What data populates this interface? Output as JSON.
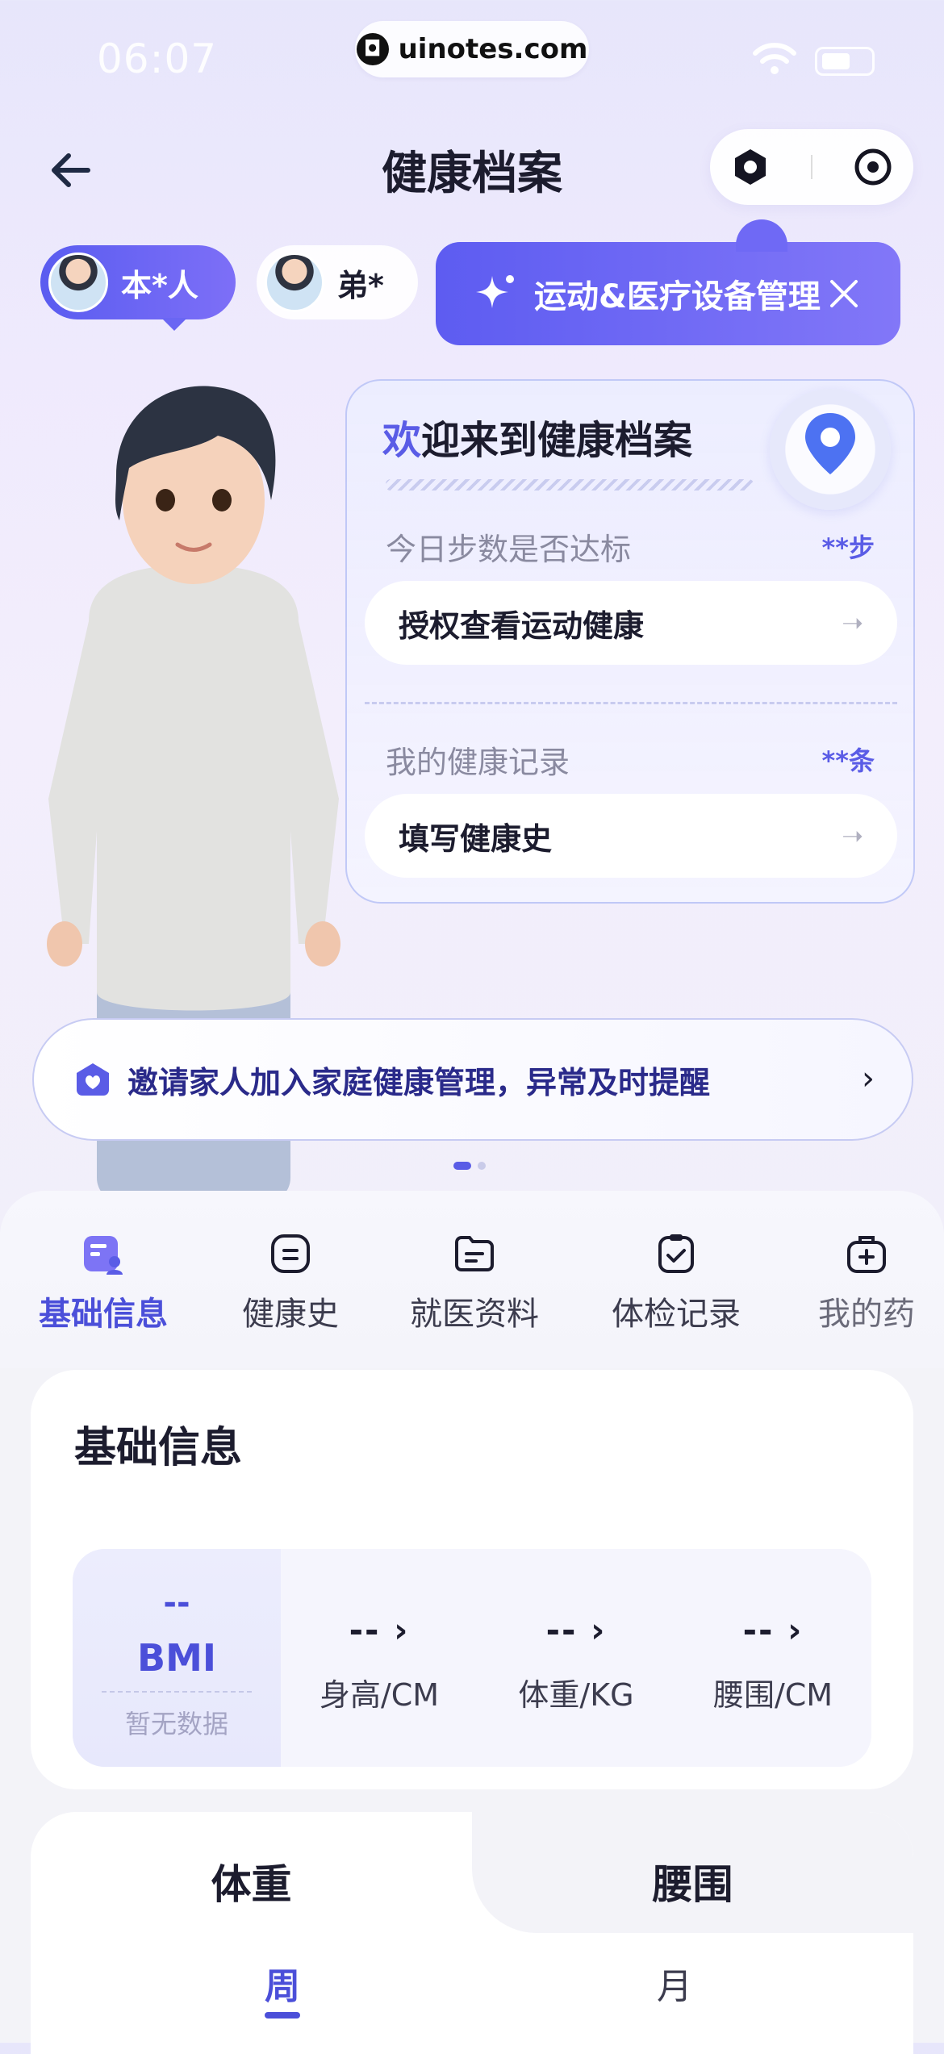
{
  "status_bar": {
    "time": "06:07",
    "url": "uinotes.com"
  },
  "header": {
    "title": "健康档案"
  },
  "profiles": [
    {
      "label": "本*人",
      "active": true
    },
    {
      "label": "弟*",
      "active": false
    }
  ],
  "device_banner": {
    "label": "运动&医疗设备管理"
  },
  "welcome": {
    "title_highlight": "欢",
    "title_rest": "迎来到健康档案",
    "steps_label": "今日步数是否达标",
    "steps_count": "**步",
    "steps_action": "授权查看运动健康",
    "records_label": "我的健康记录",
    "records_count": "**条",
    "records_action": "填写健康史"
  },
  "invite": {
    "text": "邀请家人加入家庭健康管理，异常及时提醒"
  },
  "tabs": [
    {
      "label": "基础信息",
      "icon": "id-card-icon",
      "active": true
    },
    {
      "label": "健康史",
      "icon": "chat-face-icon",
      "active": false
    },
    {
      "label": "就医资料",
      "icon": "folder-icon",
      "active": false
    },
    {
      "label": "体检记录",
      "icon": "checklist-icon",
      "active": false
    },
    {
      "label": "我的药",
      "icon": "medicine-bag-icon",
      "active": false
    }
  ],
  "basic_info": {
    "title": "基础信息",
    "bmi": {
      "value": "--",
      "name": "BMI",
      "empty": "暂无数据"
    },
    "metrics": [
      {
        "value": "-- ›",
        "label": "身高/CM"
      },
      {
        "value": "-- ›",
        "label": "体重/KG"
      },
      {
        "value": "-- ›",
        "label": "腰围/CM"
      }
    ]
  },
  "chart_tabs": {
    "weight": "体重",
    "waist": "腰围"
  },
  "periods": {
    "week": "周",
    "month": "月",
    "active": "week"
  },
  "colors": {
    "accent": "#5a5ce6",
    "banner": "#6f69f5"
  }
}
